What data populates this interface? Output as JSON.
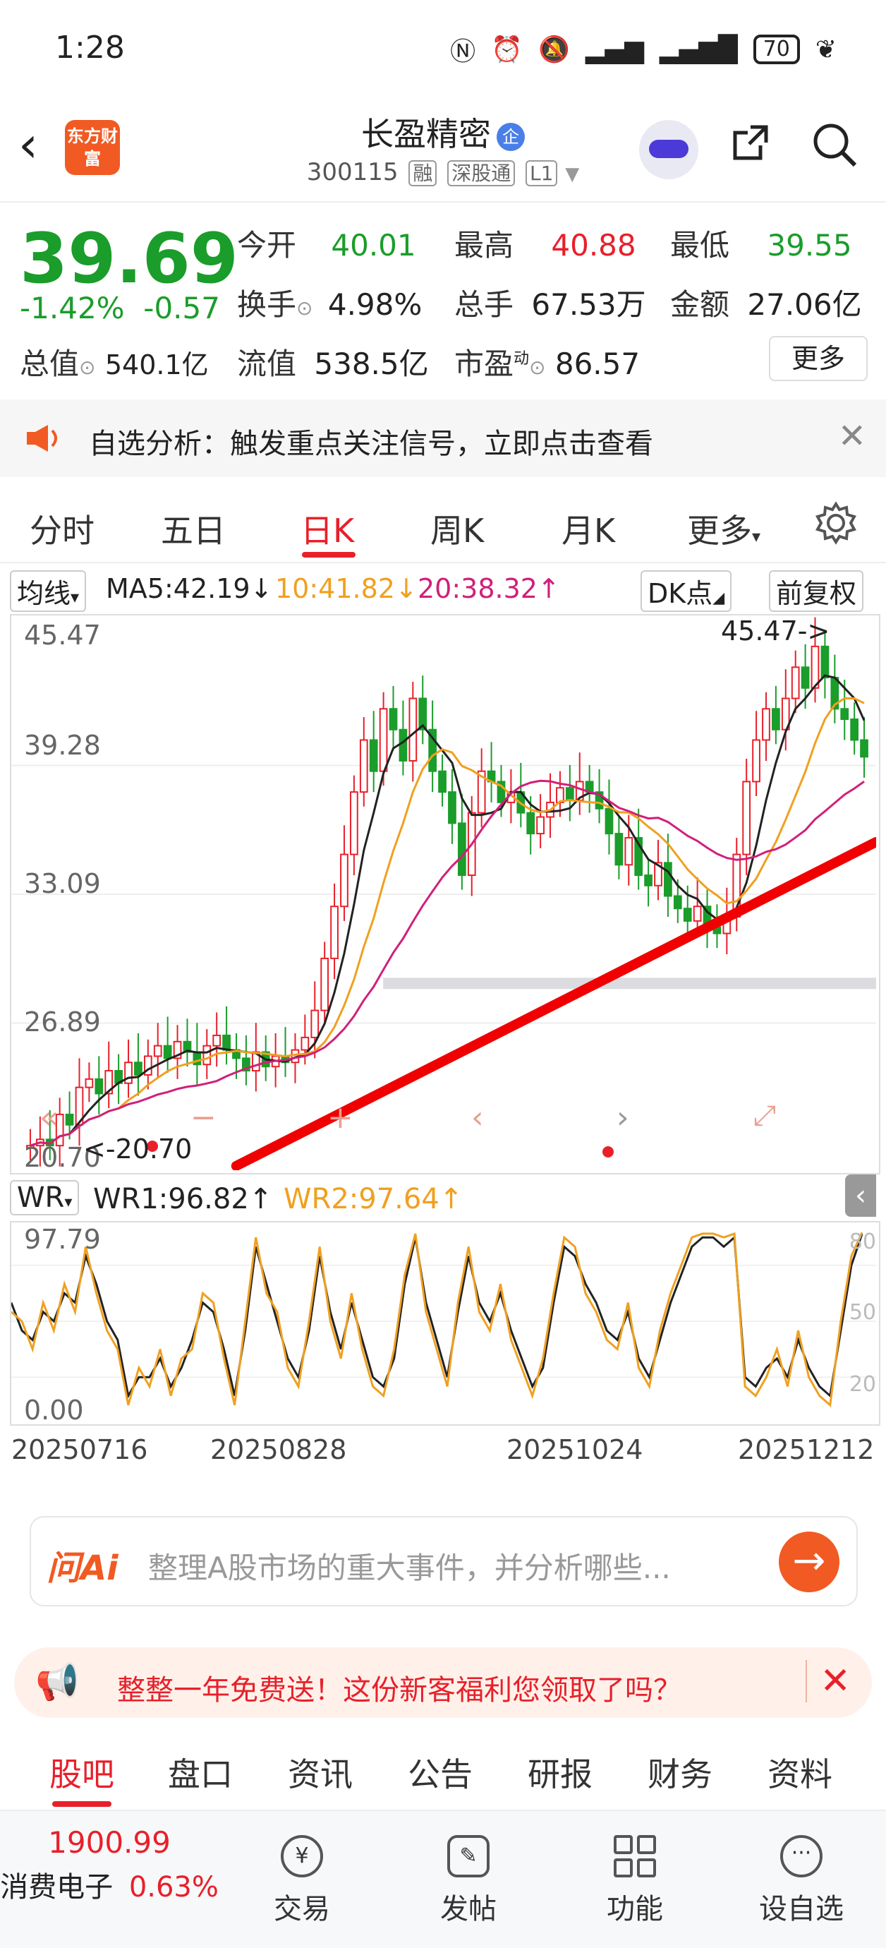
{
  "status": {
    "time": "1:28",
    "battery": "70"
  },
  "header": {
    "logo_text": "东方财富",
    "stock_name": "长盈精密",
    "name_badge": "企",
    "code": "300115",
    "tags": [
      "融",
      "深股通",
      "L1"
    ]
  },
  "quote": {
    "price": "39.69",
    "change_pct": "-1.42%",
    "change_abs": "-0.57",
    "open_label": "今开",
    "open": "40.01",
    "high_label": "最高",
    "high": "40.88",
    "low_label": "最低",
    "low": "39.55",
    "turnover_label": "换手",
    "turnover": "4.98%",
    "volume_label": "总手",
    "volume": "67.53万",
    "amount_label": "金额",
    "amount": "27.06亿",
    "mktcap_label": "总值",
    "mktcap": "540.1亿",
    "float_label": "流值",
    "float_cap": "538.5亿",
    "pe_label": "市盈",
    "pe_sup": "动",
    "pe": "86.57",
    "more": "更多"
  },
  "notice": {
    "text": "自选分析：触发重点关注信号，立即点击查看"
  },
  "tabs": [
    "分时",
    "五日",
    "日K",
    "周K",
    "月K",
    "更多",
    "设置"
  ],
  "active_tab": "日K",
  "indicator": {
    "selector": "均线",
    "ma5": "MA5:42.19↓",
    "ma10": "10:41.82↓",
    "ma20": "20:38.32↑",
    "dk": "DK点",
    "fq": "前复权"
  },
  "chart_data": {
    "type": "candlestick",
    "y_ticks": [
      "45.47",
      "39.28",
      "33.09",
      "26.89",
      "20.70"
    ],
    "ylim": [
      20.7,
      45.47
    ],
    "annotations": {
      "high_marker": "45.47->",
      "low_marker": "<-20.70"
    },
    "x_ticks": [
      "20250716",
      "20250828",
      "20251024",
      "20251212"
    ],
    "ma5_color": "#222222",
    "ma10_color": "#f0a020",
    "ma20_color": "#d0207a",
    "up_color": "#e8202a",
    "down_color": "#1a9d2a",
    "closes": [
      21.0,
      21.3,
      21.0,
      22.5,
      22.0,
      23.8,
      24.2,
      23.5,
      24.6,
      24.0,
      25.0,
      24.4,
      25.3,
      25.8,
      25.2,
      26.0,
      25.5,
      24.9,
      25.8,
      26.3,
      25.6,
      25.2,
      24.6,
      25.5,
      24.8,
      25.3,
      25.0,
      25.6,
      26.2,
      27.5,
      30.0,
      32.5,
      35.0,
      38.0,
      40.5,
      39.0,
      42.0,
      41.0,
      39.5,
      42.5,
      41.0,
      39.0,
      38.0,
      36.5,
      34.0,
      37.0,
      39.0,
      38.5,
      37.5,
      38.0,
      37.0,
      36.0,
      36.8,
      37.5,
      38.2,
      37.6,
      38.5,
      38.0,
      37.2,
      36.0,
      34.5,
      35.8,
      34.0,
      33.5,
      34.6,
      33.0,
      32.4,
      31.8,
      32.5,
      31.5,
      31.2,
      32.0,
      35.0,
      38.5,
      40.5,
      42.0,
      41.0,
      42.5,
      44.0,
      43.0,
      45.0,
      43.5,
      42.0,
      41.5,
      40.5,
      39.69
    ],
    "ma5_last": 42.19,
    "ma10_last": 41.82,
    "ma20_last": 38.32,
    "trendline": {
      "from": [
        0.26,
        20.7
      ],
      "to": [
        1.0,
        35.6
      ]
    },
    "band_level": 28.8
  },
  "wr": {
    "selector": "WR",
    "wr1": "WR1:96.82↑",
    "wr2": "WR2:97.64↑",
    "y_top": "97.79",
    "y_bottom": "0.00",
    "right_ticks": [
      "80",
      "50",
      "20"
    ],
    "wr1_values": [
      60,
      45,
      40,
      55,
      50,
      65,
      60,
      85,
      70,
      50,
      40,
      10,
      20,
      20,
      30,
      15,
      25,
      40,
      60,
      55,
      35,
      10,
      45,
      90,
      70,
      50,
      30,
      20,
      45,
      85,
      55,
      35,
      60,
      40,
      20,
      15,
      30,
      70,
      95,
      60,
      40,
      20,
      55,
      85,
      60,
      50,
      65,
      45,
      30,
      15,
      25,
      60,
      90,
      85,
      70,
      60,
      45,
      40,
      55,
      30,
      20,
      40,
      60,
      75,
      90,
      95,
      95,
      90,
      95,
      20,
      15,
      25,
      30,
      20,
      40,
      25,
      15,
      10,
      45,
      80,
      96.82
    ],
    "wr2_values": [
      55,
      50,
      35,
      60,
      45,
      70,
      55,
      90,
      65,
      45,
      35,
      5,
      25,
      15,
      35,
      10,
      30,
      35,
      65,
      60,
      30,
      5,
      50,
      95,
      65,
      55,
      25,
      15,
      50,
      90,
      50,
      30,
      65,
      35,
      15,
      10,
      35,
      75,
      97,
      55,
      35,
      15,
      60,
      90,
      55,
      45,
      70,
      40,
      25,
      10,
      30,
      65,
      95,
      90,
      65,
      55,
      40,
      35,
      60,
      25,
      15,
      45,
      65,
      80,
      95,
      97,
      97,
      95,
      97,
      15,
      10,
      20,
      35,
      15,
      45,
      20,
      10,
      5,
      50,
      85,
      97.64
    ]
  },
  "ai": {
    "logo": "问Ai",
    "placeholder": "整理A股市场的重大事件，并分析哪些..."
  },
  "promo": {
    "text": "整整一年免费送！这份新客福利您领取了吗？"
  },
  "bottom_tabs": [
    "股吧",
    "盘口",
    "资讯",
    "公告",
    "研报",
    "财务",
    "资料"
  ],
  "bottom_nav": {
    "index_value": "1900.99",
    "index_name": "消费电子",
    "index_change": "0.63%",
    "items": [
      "交易",
      "发帖",
      "功能",
      "设自选"
    ]
  }
}
